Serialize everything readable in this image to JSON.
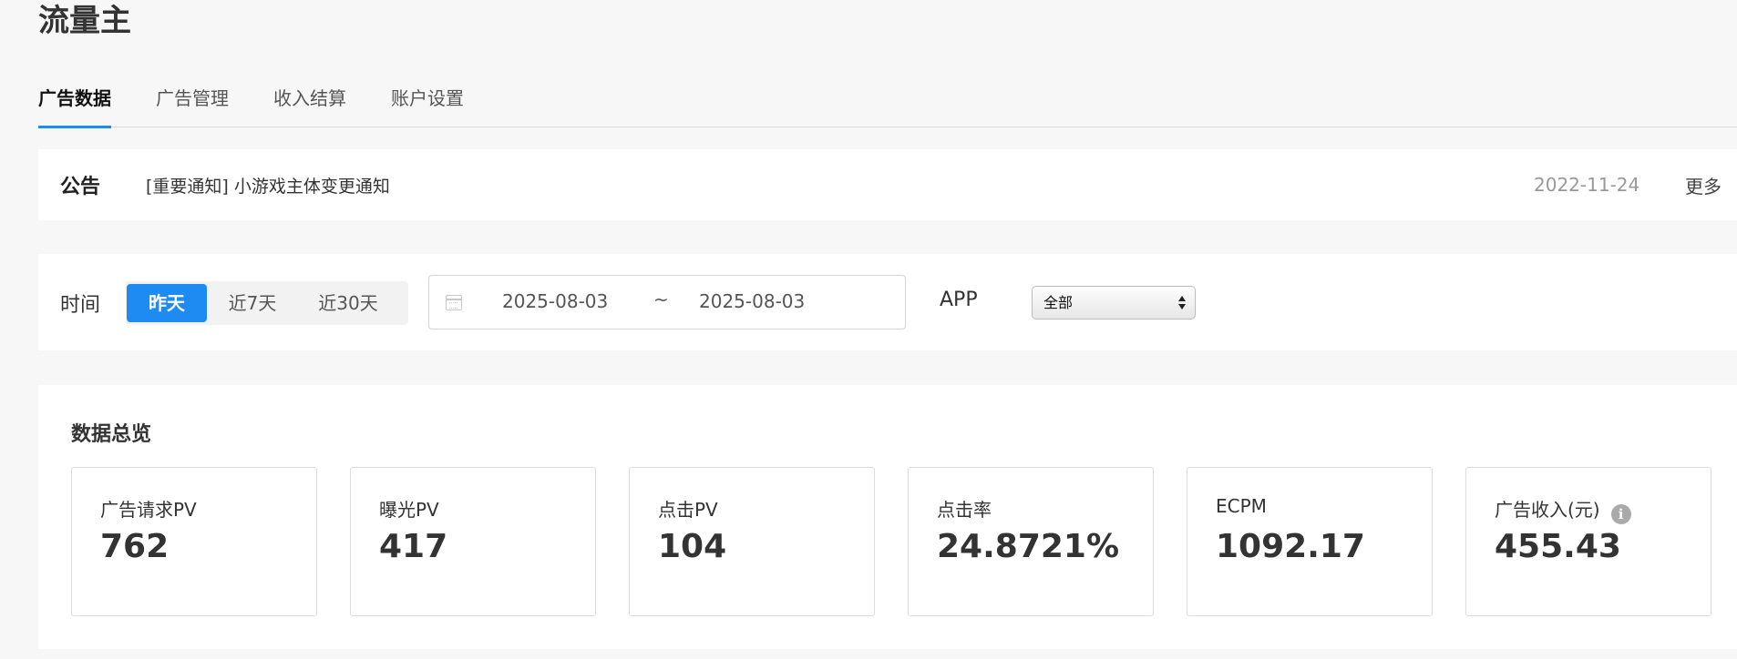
{
  "page_title": "流量主",
  "tabs": [
    {
      "label": "广告数据",
      "active": true
    },
    {
      "label": "广告管理"
    },
    {
      "label": "收入结算"
    },
    {
      "label": "账户设置"
    }
  ],
  "notice": {
    "label": "公告",
    "text": "[重要通知] 小游戏主体变更通知",
    "date": "2022-11-24",
    "more": "更多"
  },
  "filter": {
    "time_label": "时间",
    "ranges": [
      "昨天",
      "近7天",
      "近30天"
    ],
    "selected_range": "昨天",
    "date_start": "2025-08-03",
    "date_separator": "~",
    "date_end": "2025-08-03",
    "app_label": "APP",
    "app_selected": "全部"
  },
  "overview": {
    "title": "数据总览",
    "cards": [
      {
        "label": "广告请求PV",
        "value": "762"
      },
      {
        "label": "曝光PV",
        "value": "417"
      },
      {
        "label": "点击PV",
        "value": "104"
      },
      {
        "label": "点击率",
        "value": "24.8721%"
      },
      {
        "label": "ECPM",
        "value": "1092.17"
      },
      {
        "label": "广告收入(元)",
        "value": "455.43",
        "info_icon": "info-icon"
      }
    ]
  },
  "colors": {
    "accent": "#1e8bf2",
    "background": "#f7f7f7",
    "muted_text": "#999999"
  }
}
